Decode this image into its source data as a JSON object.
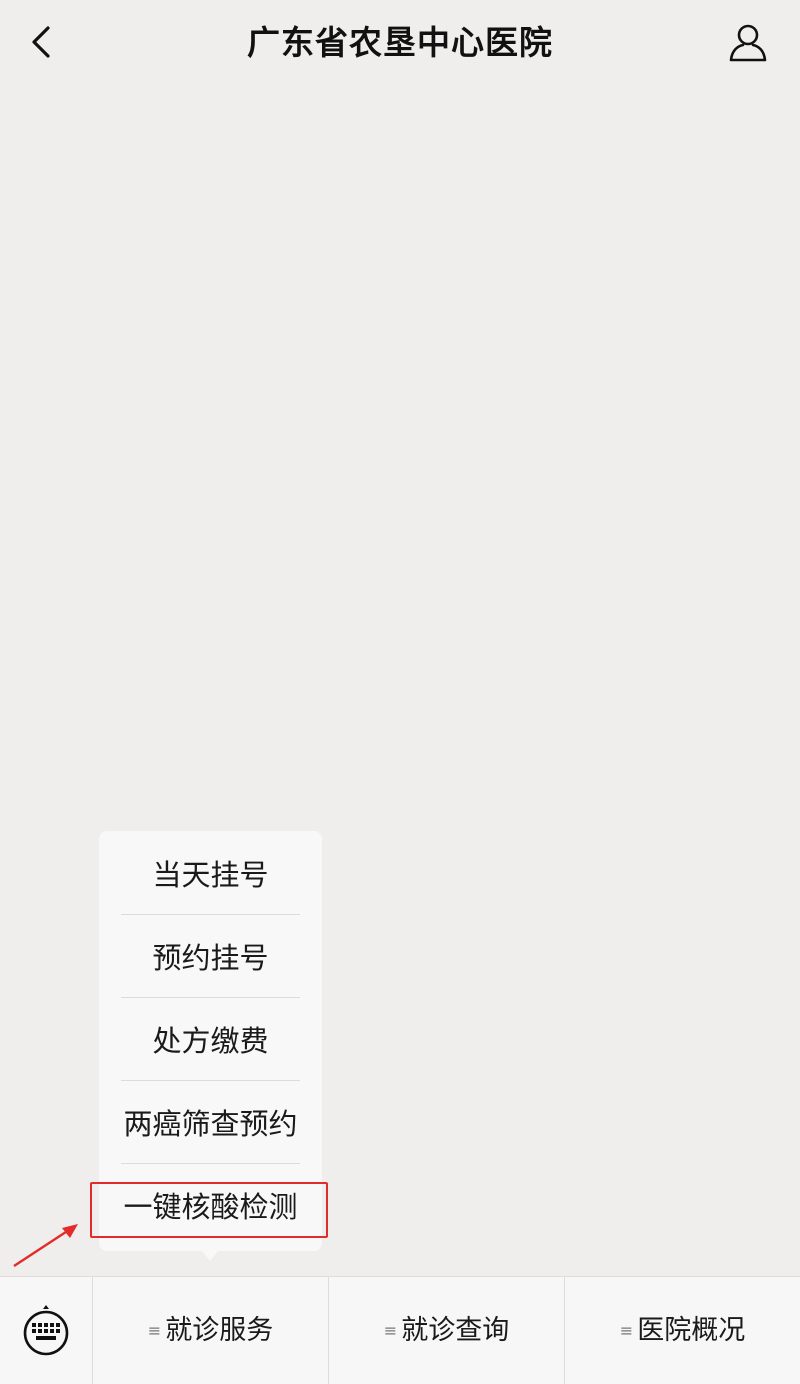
{
  "header": {
    "title": "广东省农垦中心医院",
    "back_icon": "chevron-left-icon",
    "profile_icon": "user-icon"
  },
  "popup_menu": {
    "items": [
      {
        "label": "当天挂号"
      },
      {
        "label": "预约挂号"
      },
      {
        "label": "处方缴费"
      },
      {
        "label": "两癌筛查预约"
      },
      {
        "label": "一键核酸检测"
      }
    ],
    "highlighted_index": 4
  },
  "annotation": {
    "color": "#e32b2b"
  },
  "bottom_menu": {
    "keyboard_icon": "keyboard-icon",
    "menu_glyph": "≡",
    "tabs": [
      {
        "label": "就诊服务"
      },
      {
        "label": "就诊查询"
      },
      {
        "label": "医院概况"
      }
    ]
  }
}
